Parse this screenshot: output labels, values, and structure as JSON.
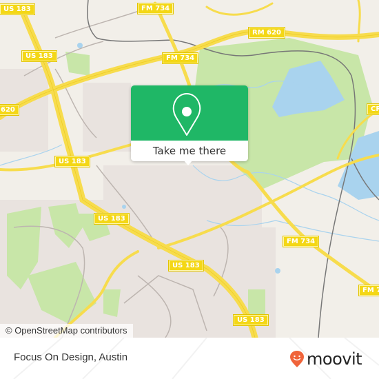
{
  "map": {
    "attribution": "© OpenStreetMap contributors",
    "road_labels": [
      {
        "id": "us183-top",
        "text": "US 183"
      },
      {
        "id": "fm734-top",
        "text": "FM 734"
      },
      {
        "id": "rm620",
        "text": "RM 620"
      },
      {
        "id": "us183-nw",
        "text": "US 183"
      },
      {
        "id": "fm734-mid",
        "text": "FM 734"
      },
      {
        "id": "rm620-left",
        "text": "620"
      },
      {
        "id": "cr-right",
        "text": "CR"
      },
      {
        "id": "us183-mid",
        "text": "US 183"
      },
      {
        "id": "us183-lower",
        "text": "US 183"
      },
      {
        "id": "fm734-lower",
        "text": "FM 734"
      },
      {
        "id": "us183-center",
        "text": "US 183"
      },
      {
        "id": "fm734-right",
        "text": "FM 7"
      },
      {
        "id": "us183-bottom",
        "text": "US 183"
      }
    ],
    "colors": {
      "land": "#f2efe9",
      "park": "#c8e6a8",
      "water": "#a9d3ee",
      "highway": "#f7dc4d",
      "residential": "#e8e0dc"
    }
  },
  "popup": {
    "icon": "map-pin-icon",
    "button_label": "Take me there",
    "color": "#1fb766"
  },
  "footer": {
    "place_name": "Focus On Design, Austin",
    "brand": "moovit",
    "brand_color": "#f0643a"
  }
}
